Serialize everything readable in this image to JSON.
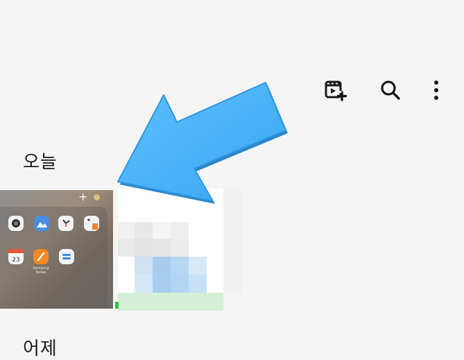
{
  "toolbar": {
    "icons": [
      {
        "name": "create-movie-icon"
      },
      {
        "name": "search-icon"
      },
      {
        "name": "more-options-icon"
      }
    ]
  },
  "sections": {
    "today_label": "오늘",
    "yesterday_label": "어제"
  },
  "thumbnails": {
    "home_screen": {
      "plus_glyph": "+",
      "app_labels": [
        "",
        "",
        "",
        "",
        "",
        "Samsung Notes",
        ""
      ]
    }
  },
  "annotation": {
    "arrow_color": "#4db3f5"
  }
}
